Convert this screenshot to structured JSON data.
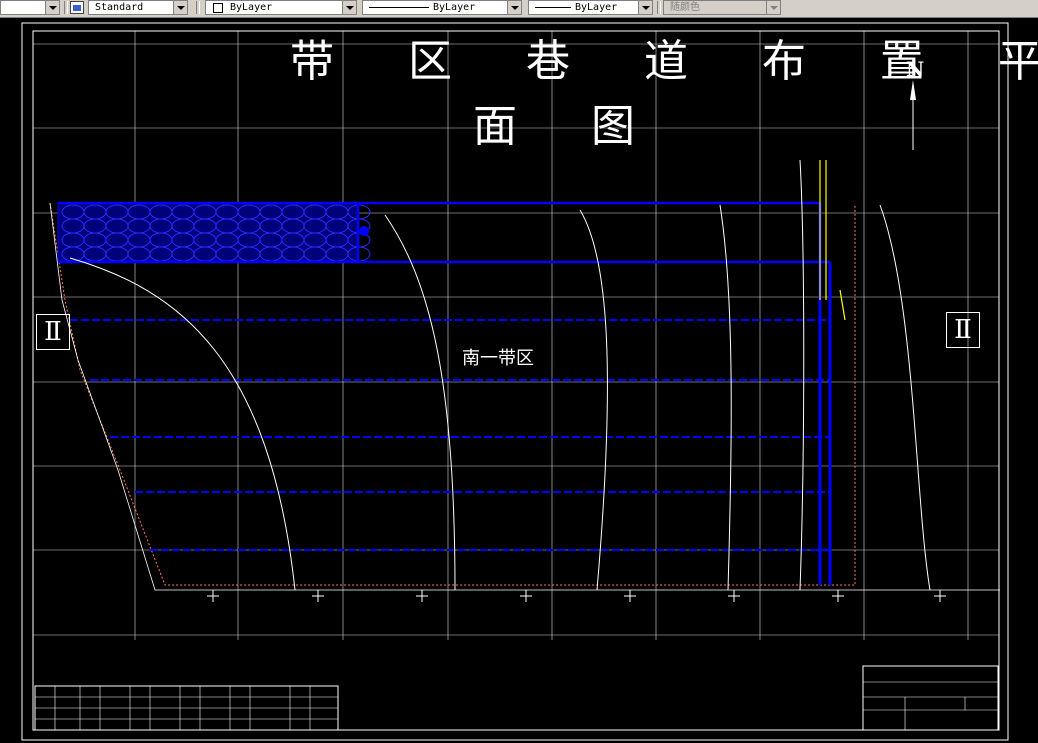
{
  "toolbar": {
    "text_style": "Standard",
    "layer_control": "ByLayer",
    "linetype_control": "ByLayer",
    "lineweight_control": "ByLayer",
    "plot_style": "随颜色"
  },
  "drawing": {
    "title_line1": "带 区 巷 道 布 置 平",
    "title_line2": "面 图",
    "zone_label": "南一带区",
    "section_left": "Ⅱ",
    "section_right": "Ⅱ",
    "north_label": "N"
  },
  "colors": {
    "background": "#000000",
    "roadway": "#0000ff",
    "boundary": "#ff7f50",
    "contour": "#ffffff",
    "highlight": "#ffff00"
  }
}
